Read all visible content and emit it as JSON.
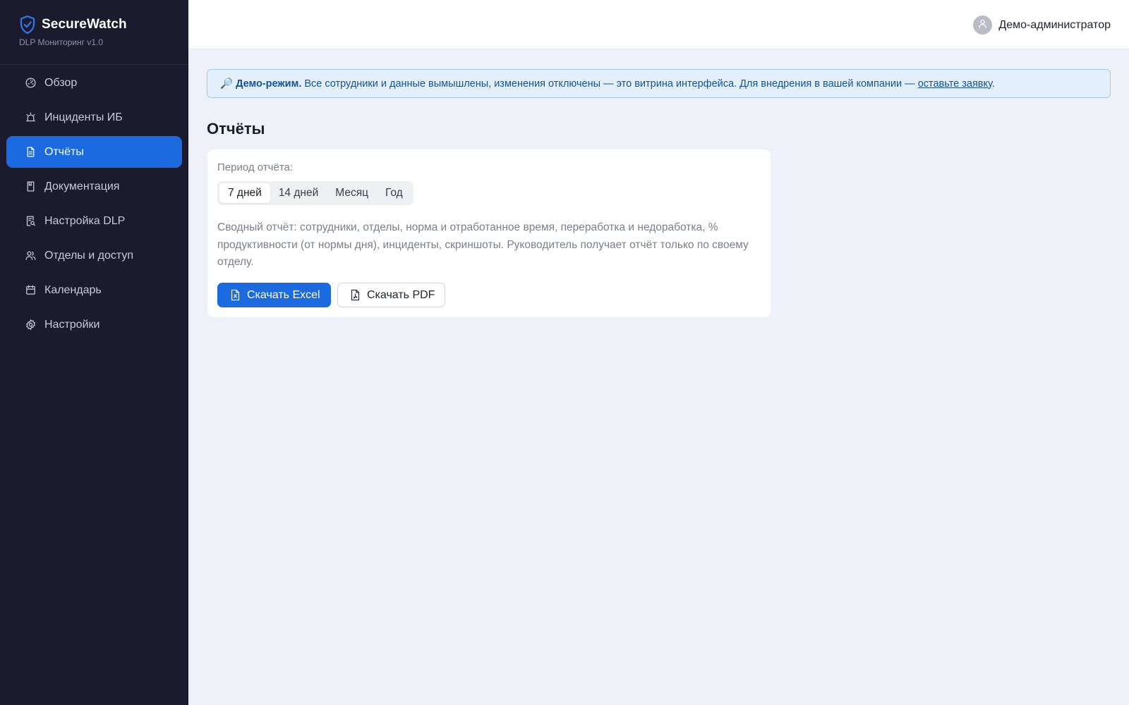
{
  "brand": {
    "title": "SecureWatch",
    "subtitle": "DLP Мониторинг v1.0",
    "icon": "shield-check-icon"
  },
  "sidebar": {
    "items": [
      {
        "label": "Обзор",
        "icon": "dashboard-gauge-icon",
        "active": false
      },
      {
        "label": "Инциденты ИБ",
        "icon": "alarm-icon",
        "active": false
      },
      {
        "label": "Отчёты",
        "icon": "document-icon",
        "active": true
      },
      {
        "label": "Документация",
        "icon": "book-icon",
        "active": false
      },
      {
        "label": "Настройка DLP",
        "icon": "document-search-icon",
        "active": false
      },
      {
        "label": "Отделы и доступ",
        "icon": "users-icon",
        "active": false
      },
      {
        "label": "Календарь",
        "icon": "calendar-icon",
        "active": false
      },
      {
        "label": "Настройки",
        "icon": "gear-icon",
        "active": false
      }
    ]
  },
  "header": {
    "user_name": "Демо-администратор",
    "avatar_icon": "user-icon"
  },
  "banner": {
    "emoji": "🔎",
    "bold": "Демо-режим.",
    "text": "Все сотрудники и данные вымышлены, изменения отключены — это витрина интерфейса. Для внедрения в вашей компании — ",
    "link": "оставьте заявку",
    "tail": "."
  },
  "page": {
    "title": "Отчёты"
  },
  "report": {
    "period_label": "Период отчёта:",
    "periods": [
      "7 дней",
      "14 дней",
      "Месяц",
      "Год"
    ],
    "selected_period": "7 дней",
    "description": "Сводный отчёт: сотрудники, отделы, норма и отработанное время, переработка и недоработка, % продуктивности (от нормы дня), инциденты, скриншоты. Руководитель получает отчёт только по своему отделу.",
    "excel_label": "Скачать Excel",
    "pdf_label": "Скачать PDF"
  },
  "colors": {
    "accent": "#1b6ae0",
    "sidebar_bg": "#1c1b2e",
    "page_bg": "#eef1f7",
    "banner_bg": "#e3f0fc"
  }
}
